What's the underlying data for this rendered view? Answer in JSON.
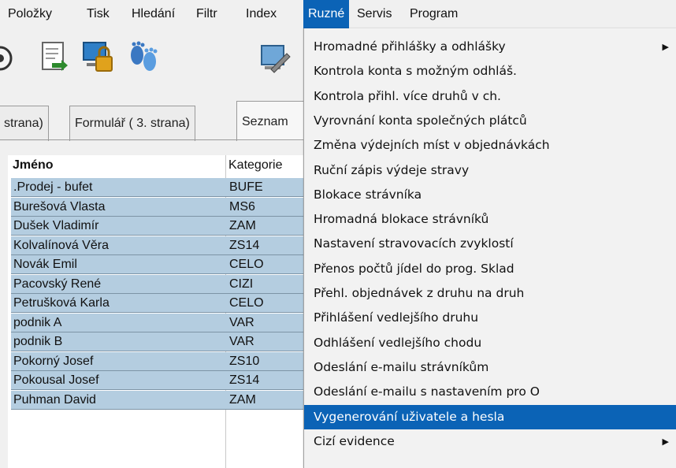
{
  "menubar": {
    "items": [
      "Položky",
      "Tisk",
      "Hledání",
      "Filtr",
      "Index",
      "Ruzné",
      "Servis",
      "Program"
    ],
    "active": "Ruzné"
  },
  "toolbar": {
    "icons": [
      "partial-icon",
      "document-import-icon",
      "lock-computer-icon",
      "footprints-icon",
      "tools-icon"
    ]
  },
  "tabs": [
    "strana)",
    "Formulář ( 3. strana)",
    "Seznam"
  ],
  "grid": {
    "columns": [
      "Jméno",
      "Kategorie"
    ],
    "rows": [
      [
        ".Prodej - bufet",
        "BUFE"
      ],
      [
        "Burešová Vlasta",
        "MS6"
      ],
      [
        "Dušek Vladimír",
        "ZAM"
      ],
      [
        "Kolvalínová Věra",
        "ZS14"
      ],
      [
        "Novák Emil",
        "CELO"
      ],
      [
        "Pacovský René",
        "CIZI"
      ],
      [
        "Petrušková Karla",
        "CELO"
      ],
      [
        "podnik A",
        "VAR"
      ],
      [
        "podnik B",
        "VAR"
      ],
      [
        "Pokorný Josef",
        "ZS10"
      ],
      [
        "Pokousal Josef",
        "ZS14"
      ],
      [
        "Puhman David",
        "ZAM"
      ]
    ]
  },
  "menu": {
    "items": [
      {
        "label": "Hromadné přihlášky a odhlášky",
        "submenu": true
      },
      {
        "label": "Kontrola konta s možným odhláš.",
        "submenu": false
      },
      {
        "label": "Kontrola přihl. více druhů v ch.",
        "submenu": false
      },
      {
        "label": "Vyrovnání konta společných plátců",
        "submenu": false
      },
      {
        "label": "Změna výdejních míst v objednávkách",
        "submenu": false
      },
      {
        "label": "Ruční zápis výdeje stravy",
        "submenu": false
      },
      {
        "label": "Blokace strávníka",
        "submenu": false
      },
      {
        "label": "Hromadná blokace strávníků",
        "submenu": false
      },
      {
        "label": "Nastavení stravovacích zvyklostí",
        "submenu": false
      },
      {
        "label": "Přenos počtů jídel do prog. Sklad",
        "submenu": false
      },
      {
        "label": "Přehl. objednávek z druhu na druh",
        "submenu": false
      },
      {
        "label": "Přihlášení vedlejšího druhu",
        "submenu": false
      },
      {
        "label": "Odhlášení vedlejšího chodu",
        "submenu": false
      },
      {
        "label": "Odeslání e-mailu strávníkům",
        "submenu": false
      },
      {
        "label": "Odeslání e-mailu s nastavením pro O",
        "submenu": false
      },
      {
        "label": "Vygenerování uživatele a hesla",
        "submenu": false
      },
      {
        "label": "Cizí evidence",
        "submenu": true
      }
    ],
    "highlighted": "Vygenerování uživatele a hesla",
    "arrow_glyph": "▶"
  },
  "colors": {
    "accent": "#0b63b6",
    "row_bg": "#b4cde0"
  }
}
